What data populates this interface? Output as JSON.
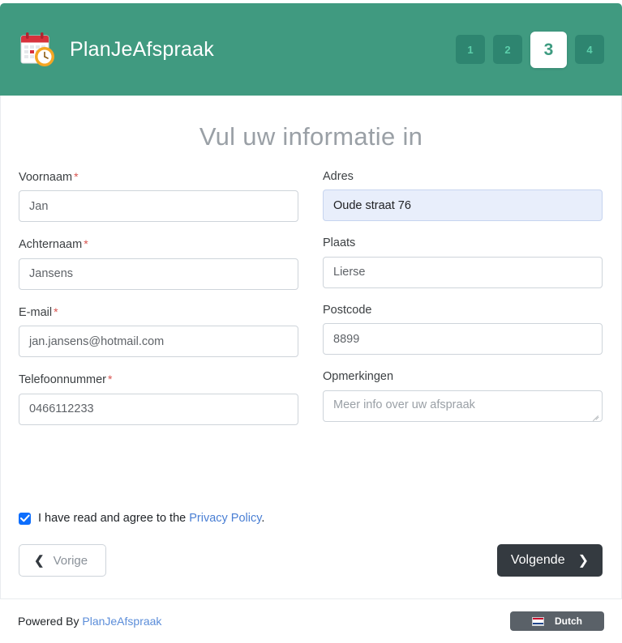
{
  "header": {
    "brand_title": "PlanJeAfspraak",
    "logo_icon": "calendar-clock-icon",
    "steps": [
      {
        "label": "1",
        "active": false
      },
      {
        "label": "2",
        "active": false
      },
      {
        "label": "3",
        "active": true
      },
      {
        "label": "4",
        "active": false
      }
    ],
    "bg_color": "#409a80",
    "step_bg_color": "#2e8570",
    "step_text_color": "#5ccfab",
    "active_step_text_color": "#3d9b80"
  },
  "main": {
    "title": "Vul uw informatie in",
    "left_fields": [
      {
        "label": "Voornaam",
        "required": true,
        "value": "Jan",
        "placeholder": ""
      },
      {
        "label": "Achternaam",
        "required": true,
        "value": "Jansens",
        "placeholder": ""
      },
      {
        "label": "E-mail",
        "required": true,
        "value": "jan.jansens@hotmail.com",
        "placeholder": ""
      },
      {
        "label": "Telefoonnummer",
        "required": true,
        "value": "0466112233",
        "placeholder": ""
      }
    ],
    "right_fields": [
      {
        "label": "Adres",
        "required": false,
        "value": "Oude straat 76",
        "placeholder": "",
        "autofilled": true
      },
      {
        "label": "Plaats",
        "required": false,
        "value": "Lierse",
        "placeholder": ""
      },
      {
        "label": "Postcode",
        "required": false,
        "value": "8899",
        "placeholder": ""
      }
    ],
    "comments": {
      "label": "Opmerkingen",
      "value": "",
      "placeholder": "Meer info over uw afspraak"
    },
    "required_marker": "*"
  },
  "consent": {
    "checked": true,
    "text_before": "I have read and agree to the ",
    "link_label": "Privacy Policy",
    "text_after": "."
  },
  "nav": {
    "prev_label": "Vorige",
    "prev_icon": "chevron-left-icon",
    "next_label": "Volgende",
    "next_icon": "chevron-right-icon",
    "next_bg_color": "#343a40"
  },
  "footer": {
    "powered_prefix": "Powered By ",
    "powered_link": "PlanJeAfspraak",
    "language_label": "Dutch",
    "language_icon": "dutch-flag-icon"
  }
}
